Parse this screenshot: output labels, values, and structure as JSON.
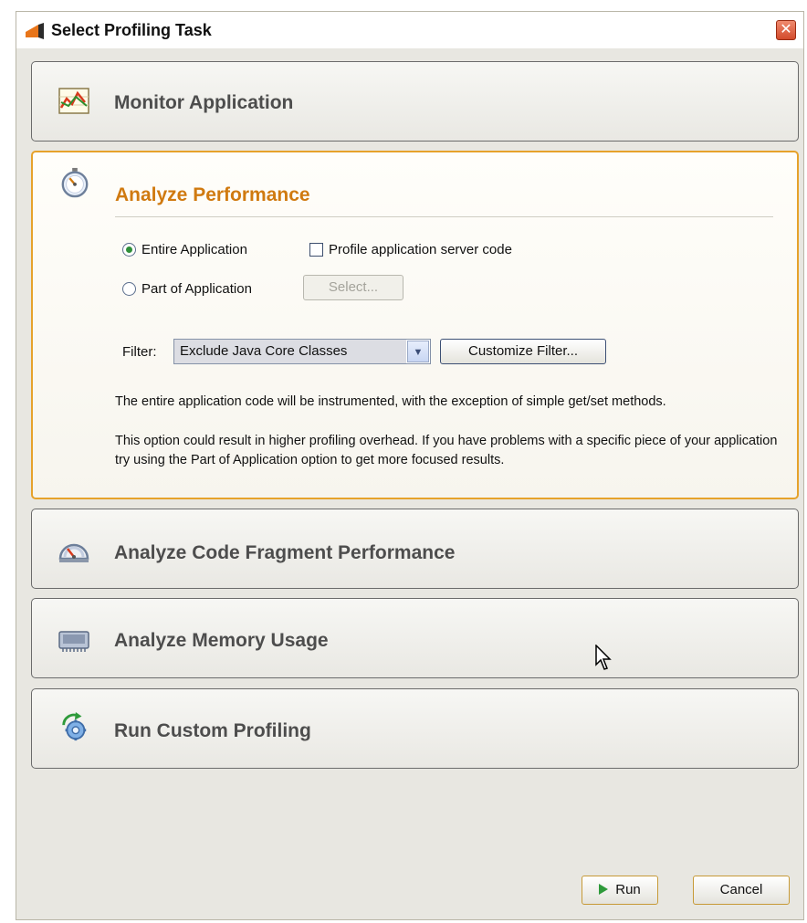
{
  "window": {
    "title": "Select Profiling Task",
    "close_glyph": "✕"
  },
  "panels": {
    "monitor": {
      "title": "Monitor Application",
      "icon": "monitor-chart-icon"
    },
    "performance": {
      "title": "Analyze Performance",
      "icon": "stopwatch-icon",
      "entire_label": "Entire Application",
      "part_label": "Part of Application",
      "server_code_label": "Profile application server code",
      "select_button": "Select...",
      "filter_label": "Filter:",
      "filter_value": "Exclude Java Core Classes",
      "customize_button": "Customize Filter...",
      "desc1": "The entire application code will be instrumented, with the exception of simple get/set methods.",
      "desc2": "This option could result in higher profiling overhead. If you have problems with a specific piece of your application try using the Part of Application option to get more focused results."
    },
    "fragment": {
      "title": "Analyze Code Fragment Performance",
      "icon": "gauge-icon"
    },
    "memory": {
      "title": "Analyze Memory Usage",
      "icon": "memory-chip-icon"
    },
    "custom": {
      "title": "Run Custom Profiling",
      "icon": "gear-refresh-icon"
    }
  },
  "buttons": {
    "run": "Run",
    "cancel": "Cancel"
  },
  "colors": {
    "accent": "#d07a10",
    "active_border": "#e6a22b"
  }
}
